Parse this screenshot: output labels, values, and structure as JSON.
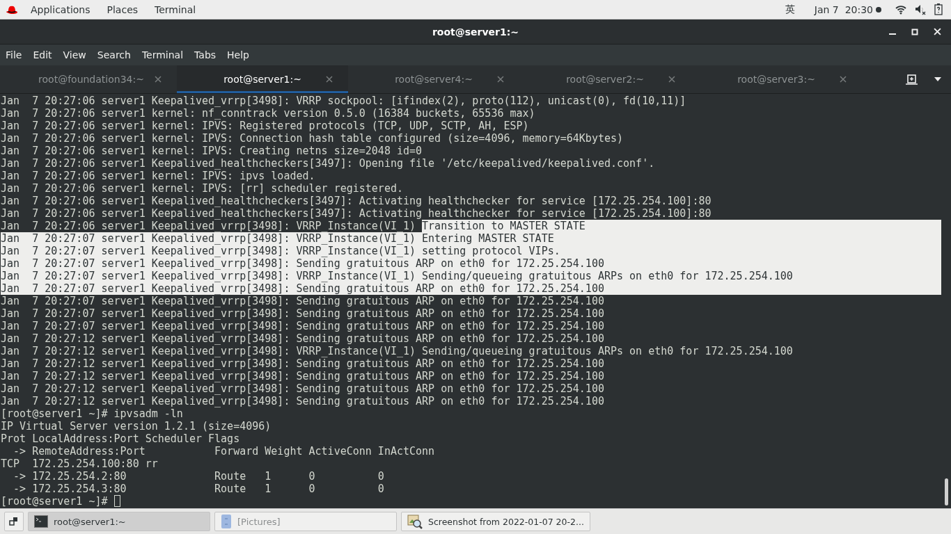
{
  "top_bar": {
    "menus": [
      "Applications",
      "Places",
      "Terminal"
    ],
    "input_method": "英",
    "clock": "Jan 7  20:30"
  },
  "window": {
    "title": "root@server1:~"
  },
  "menu_bar": [
    "File",
    "Edit",
    "View",
    "Search",
    "Terminal",
    "Tabs",
    "Help"
  ],
  "tabs": [
    {
      "label": "root@foundation34:~",
      "selected": false
    },
    {
      "label": "root@server1:~",
      "selected": true
    },
    {
      "label": "root@server4:~",
      "selected": false
    },
    {
      "label": "root@server2:~",
      "selected": false
    },
    {
      "label": "root@server3:~",
      "selected": false
    }
  ],
  "terminal": {
    "lines": [
      {
        "text": "Jan  7 20:27:06 server1 Keepalived_vrrp[3498]: VRRP sockpool: [ifindex(2), proto(112), unicast(0), fd(10,11)]",
        "selected": false
      },
      {
        "text": "Jan  7 20:27:06 server1 kernel: nf_conntrack version 0.5.0 (16384 buckets, 65536 max)",
        "selected": false
      },
      {
        "text": "Jan  7 20:27:06 server1 kernel: IPVS: Registered protocols (TCP, UDP, SCTP, AH, ESP)",
        "selected": false
      },
      {
        "text": "Jan  7 20:27:06 server1 kernel: IPVS: Connection hash table configured (size=4096, memory=64Kbytes)",
        "selected": false
      },
      {
        "text": "Jan  7 20:27:06 server1 kernel: IPVS: Creating netns size=2048 id=0",
        "selected": false
      },
      {
        "text": "Jan  7 20:27:06 server1 Keepalived_healthcheckers[3497]: Opening file '/etc/keepalived/keepalived.conf'.",
        "selected": false
      },
      {
        "text": "Jan  7 20:27:06 server1 kernel: IPVS: ipvs loaded.",
        "selected": false
      },
      {
        "text": "Jan  7 20:27:06 server1 kernel: IPVS: [rr] scheduler registered.",
        "selected": false
      },
      {
        "text": "Jan  7 20:27:06 server1 Keepalived_healthcheckers[3497]: Activating healthchecker for service [172.25.254.100]:80",
        "selected": false
      },
      {
        "text": "Jan  7 20:27:06 server1 Keepalived_healthcheckers[3497]: Activating healthchecker for service [172.25.254.100]:80",
        "selected": false
      },
      {
        "segments": [
          {
            "text": "Jan  7 20:27:06 server1 Keepalived_vrrp[3498]: VRRP_Instance(VI_1) ",
            "selected": false
          },
          {
            "text": "Transition to MASTER STATE",
            "selected": true
          }
        ]
      },
      {
        "text": "Jan  7 20:27:07 server1 Keepalived_vrrp[3498]: VRRP_Instance(VI_1) Entering MASTER STATE",
        "selected": true
      },
      {
        "text": "Jan  7 20:27:07 server1 Keepalived_vrrp[3498]: VRRP_Instance(VI_1) setting protocol VIPs.",
        "selected": true
      },
      {
        "text": "Jan  7 20:27:07 server1 Keepalived_vrrp[3498]: Sending gratuitous ARP on eth0 for 172.25.254.100",
        "selected": true
      },
      {
        "text": "Jan  7 20:27:07 server1 Keepalived_vrrp[3498]: VRRP_Instance(VI_1) Sending/queueing gratuitous ARPs on eth0 for 172.25.254.100",
        "selected": true
      },
      {
        "text": "Jan  7 20:27:07 server1 Keepalived_vrrp[3498]: Sending gratuitous ARP on eth0 for 172.25.254.100",
        "selected": true
      },
      {
        "text": "Jan  7 20:27:07 server1 Keepalived_vrrp[3498]: Sending gratuitous ARP on eth0 for 172.25.254.100",
        "selected": false
      },
      {
        "text": "Jan  7 20:27:07 server1 Keepalived_vrrp[3498]: Sending gratuitous ARP on eth0 for 172.25.254.100",
        "selected": false
      },
      {
        "text": "Jan  7 20:27:07 server1 Keepalived_vrrp[3498]: Sending gratuitous ARP on eth0 for 172.25.254.100",
        "selected": false
      },
      {
        "text": "Jan  7 20:27:12 server1 Keepalived_vrrp[3498]: Sending gratuitous ARP on eth0 for 172.25.254.100",
        "selected": false
      },
      {
        "text": "Jan  7 20:27:12 server1 Keepalived_vrrp[3498]: VRRP_Instance(VI_1) Sending/queueing gratuitous ARPs on eth0 for 172.25.254.100",
        "selected": false
      },
      {
        "text": "Jan  7 20:27:12 server1 Keepalived_vrrp[3498]: Sending gratuitous ARP on eth0 for 172.25.254.100",
        "selected": false
      },
      {
        "text": "Jan  7 20:27:12 server1 Keepalived_vrrp[3498]: Sending gratuitous ARP on eth0 for 172.25.254.100",
        "selected": false
      },
      {
        "text": "Jan  7 20:27:12 server1 Keepalived_vrrp[3498]: Sending gratuitous ARP on eth0 for 172.25.254.100",
        "selected": false
      },
      {
        "text": "Jan  7 20:27:12 server1 Keepalived_vrrp[3498]: Sending gratuitous ARP on eth0 for 172.25.254.100",
        "selected": false
      },
      {
        "text": "[root@server1 ~]# ipvsadm -ln",
        "selected": false
      },
      {
        "text": "IP Virtual Server version 1.2.1 (size=4096)",
        "selected": false
      },
      {
        "text": "Prot LocalAddress:Port Scheduler Flags",
        "selected": false
      },
      {
        "text": "  -> RemoteAddress:Port           Forward Weight ActiveConn InActConn",
        "selected": false
      },
      {
        "text": "TCP  172.25.254.100:80 rr",
        "selected": false
      },
      {
        "text": "  -> 172.25.254.2:80              Route   1      0          0",
        "selected": false
      },
      {
        "text": "  -> 172.25.254.3:80              Route   1      0          0",
        "selected": false
      }
    ],
    "prompt": {
      "text": "[root@server1 ~]# ",
      "cursor": true
    }
  },
  "taskbar": [
    {
      "label": "root@server1:~",
      "kind": "terminal",
      "active": true,
      "minimized": false
    },
    {
      "label": "[Pictures]",
      "kind": "folder",
      "active": false,
      "minimized": true
    },
    {
      "label": "Screenshot from 2022-01-07 20-2...",
      "kind": "viewer",
      "active": false,
      "minimized": false
    }
  ]
}
